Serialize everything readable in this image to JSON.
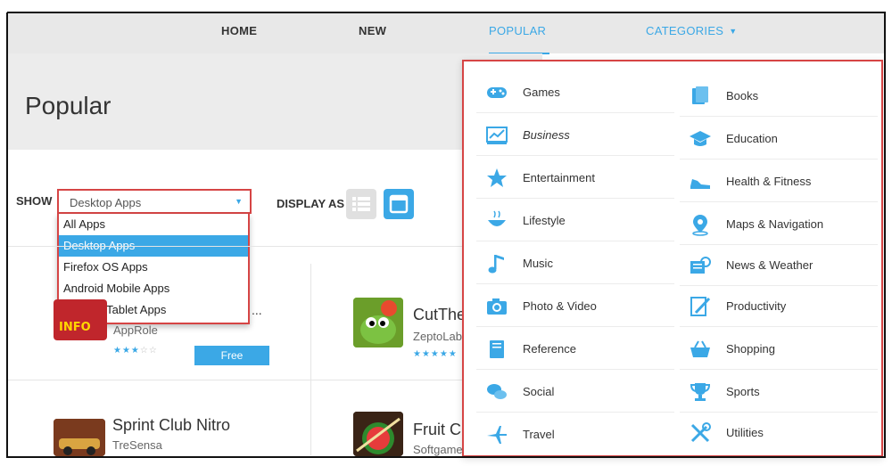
{
  "nav": {
    "home": "HOME",
    "new": "NEW",
    "popular": "POPULAR",
    "categories": "CATEGORIES"
  },
  "page": {
    "title": "Popular"
  },
  "filter": {
    "show_label": "SHOW",
    "selected": "Desktop Apps",
    "options": [
      "All Apps",
      "Desktop Apps",
      "Firefox OS Apps",
      "Android Mobile Apps",
      "Android Tablet Apps"
    ],
    "display_label": "DISPLAY AS"
  },
  "apps": [
    {
      "name": "...",
      "developer": "AppRole",
      "rating": 3,
      "price": "Free"
    },
    {
      "name": "CutThe",
      "developer": "ZeptoLab",
      "rating": 5
    },
    {
      "name": "Sprint Club Nitro",
      "developer": "TreSensa"
    },
    {
      "name": "Fruit C",
      "developer": "Softgames"
    }
  ],
  "thumb_label": "INFO",
  "categories": [
    {
      "label": "Games",
      "icon": "gamepad-icon"
    },
    {
      "label": "Books",
      "icon": "book-icon"
    },
    {
      "label": "Business",
      "icon": "chart-icon"
    },
    {
      "label": "Education",
      "icon": "graduation-cap-icon"
    },
    {
      "label": "Entertainment",
      "icon": "star-icon"
    },
    {
      "label": "Health & Fitness",
      "icon": "sneaker-icon"
    },
    {
      "label": "Lifestyle",
      "icon": "bowl-icon"
    },
    {
      "label": "Maps & Navigation",
      "icon": "map-pin-icon"
    },
    {
      "label": "Music",
      "icon": "music-note-icon"
    },
    {
      "label": "News & Weather",
      "icon": "weather-icon"
    },
    {
      "label": "Photo & Video",
      "icon": "camera-icon"
    },
    {
      "label": "Productivity",
      "icon": "pencil-icon"
    },
    {
      "label": "Reference",
      "icon": "reference-book-icon"
    },
    {
      "label": "Shopping",
      "icon": "basket-icon"
    },
    {
      "label": "Social",
      "icon": "chat-bubbles-icon"
    },
    {
      "label": "Sports",
      "icon": "trophy-icon"
    },
    {
      "label": "Travel",
      "icon": "airplane-icon"
    },
    {
      "label": "Utilities",
      "icon": "tools-icon"
    }
  ],
  "colors": {
    "accent": "#3ba8e6",
    "highlight_border": "#d64545"
  }
}
